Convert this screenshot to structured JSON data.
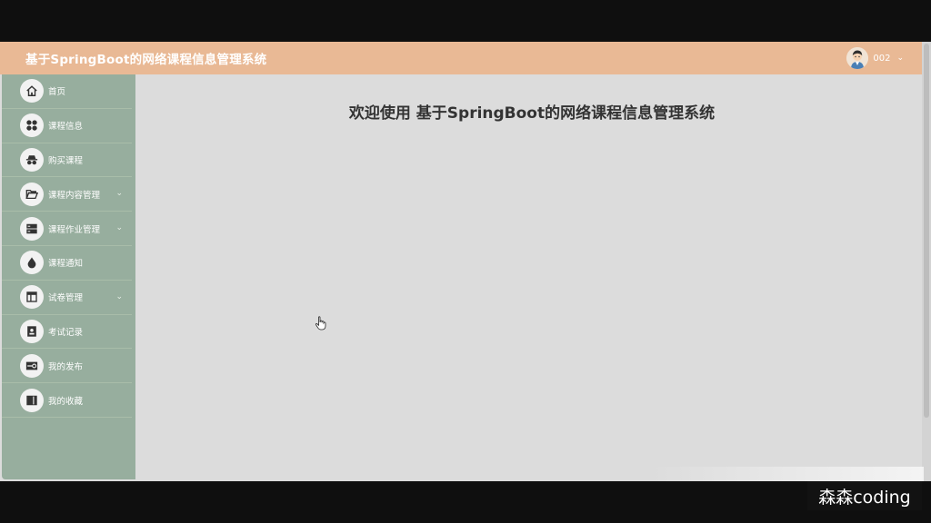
{
  "header": {
    "title": "基于SpringBoot的网络课程信息管理系统",
    "user_name": "002",
    "user_caret": "⌄"
  },
  "sidebar": {
    "items": [
      {
        "label": "首页",
        "icon": "home-icon",
        "has_submenu": false
      },
      {
        "label": "课程信息",
        "icon": "apps-icon",
        "has_submenu": false
      },
      {
        "label": "购买课程",
        "icon": "incognito-icon",
        "has_submenu": false
      },
      {
        "label": "课程内容管理",
        "icon": "folder-open-icon",
        "has_submenu": true
      },
      {
        "label": "课程作业管理",
        "icon": "server-icon",
        "has_submenu": true
      },
      {
        "label": "课程通知",
        "icon": "drop-icon",
        "has_submenu": false
      },
      {
        "label": "试卷管理",
        "icon": "layout-icon",
        "has_submenu": true
      },
      {
        "label": "考试记录",
        "icon": "id-card-icon",
        "has_submenu": false
      },
      {
        "label": "我的发布",
        "icon": "toggle-icon",
        "has_submenu": false
      },
      {
        "label": "我的收藏",
        "icon": "book-icon",
        "has_submenu": false
      }
    ],
    "caret": "⌄"
  },
  "main": {
    "welcome_text": "欢迎使用 基于SpringBoot的网络课程信息管理系统"
  },
  "watermark": {
    "text": "森森coding"
  },
  "colors": {
    "header_bg": "#e9b995",
    "sidebar_bg": "#97ae9e",
    "content_bg": "#dcdcdc",
    "icon_circle": "#f2f2f2"
  }
}
